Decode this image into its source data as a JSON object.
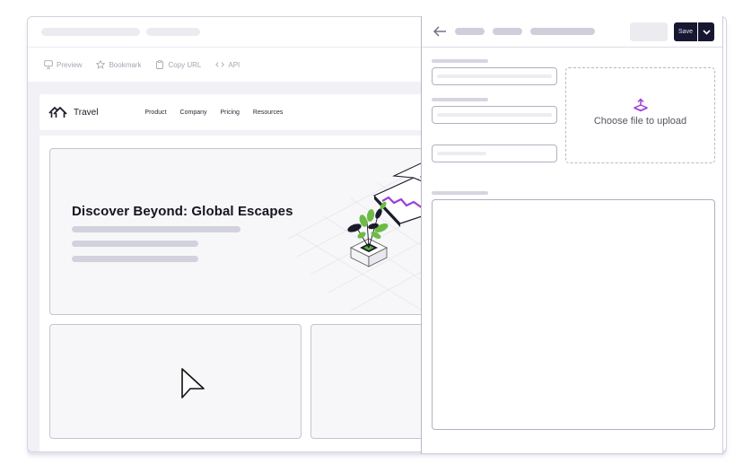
{
  "toolbar": {
    "items": [
      {
        "label": "Preview",
        "icon": "monitor-icon"
      },
      {
        "label": "Bookmark",
        "icon": "star-icon"
      },
      {
        "label": "Copy URL",
        "icon": "clipboard-icon"
      },
      {
        "label": "API",
        "icon": "code-icon"
      }
    ]
  },
  "site": {
    "logo_text": "Travel",
    "nav": [
      "Product",
      "Company",
      "Pricing",
      "Resources"
    ],
    "hero_title": "Discover Beyond: Global Escapes"
  },
  "panel": {
    "save_label": "Save",
    "upload_label": "Choose file to upload",
    "accent_color": "#a13fd6",
    "button_color": "#171732"
  }
}
